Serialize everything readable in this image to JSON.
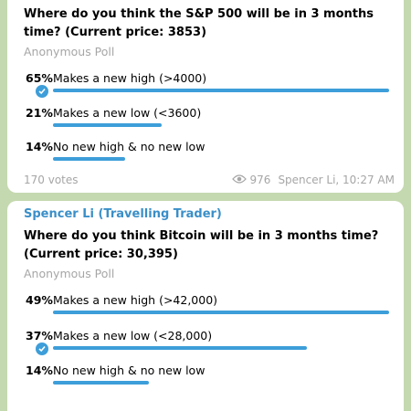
{
  "poll1": {
    "question": "Where do you think the S&P 500 will be in 3 months time? (Current price: 3853)",
    "poll_type": "Anonymous Poll",
    "options": [
      {
        "pct": "65%",
        "label": "Makes a new high (>4000)",
        "fraction": 1.0,
        "chosen": true
      },
      {
        "pct": "21%",
        "label": "Makes a new low (<3600)",
        "fraction": 0.323,
        "chosen": false
      },
      {
        "pct": "14%",
        "label": "No new high & no new low",
        "fraction": 0.215,
        "chosen": false
      }
    ],
    "votes": "170 votes",
    "views": "976",
    "author_time": "Spencer Li, 10:27 AM"
  },
  "poll2": {
    "sender": "Spencer Li (Travelling Trader)",
    "question": "Where do you think Bitcoin will be in 3 months time? (Current price: 30,395)",
    "poll_type": "Anonymous Poll",
    "options": [
      {
        "pct": "49%",
        "label": "Makes a new high (>42,000)",
        "fraction": 1.0,
        "chosen": false
      },
      {
        "pct": "37%",
        "label": "Makes a new low (<28,000)",
        "fraction": 0.755,
        "chosen": true
      },
      {
        "pct": "14%",
        "label": "No new high & no new low",
        "fraction": 0.286,
        "chosen": false
      }
    ]
  },
  "colors": {
    "accent": "#3d9ed9",
    "chat_background": "#c5d9b0",
    "muted_text": "#a6a6a6"
  }
}
